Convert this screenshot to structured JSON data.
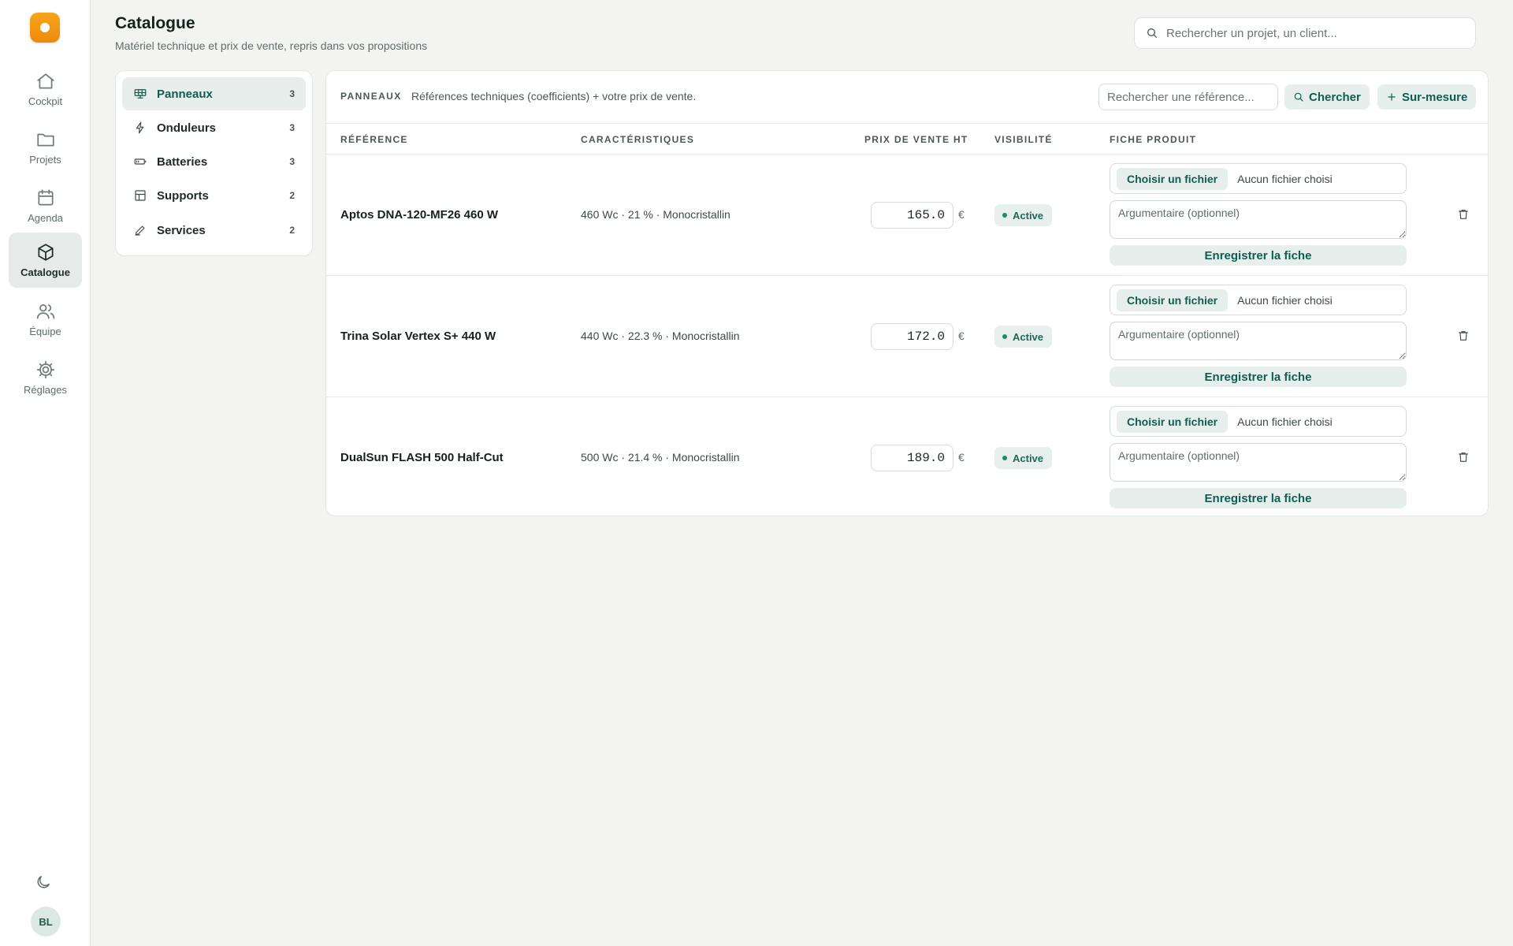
{
  "sidebar": {
    "nav": [
      {
        "label": "Cockpit",
        "icon": "home-icon",
        "active": false
      },
      {
        "label": "Projets",
        "icon": "folder-icon",
        "active": false
      },
      {
        "label": "Agenda",
        "icon": "calendar-icon",
        "active": false
      },
      {
        "label": "Catalogue",
        "icon": "box-icon",
        "active": true
      },
      {
        "label": "Équipe",
        "icon": "users-icon",
        "active": false
      },
      {
        "label": "Réglages",
        "icon": "gear-icon",
        "active": false
      }
    ],
    "user_initials": "BL"
  },
  "header": {
    "title": "Catalogue",
    "subtitle": "Matériel technique et prix de vente, repris dans vos propositions",
    "search_placeholder": "Rechercher un projet, un client..."
  },
  "categories": [
    {
      "label": "Panneaux",
      "count": "3",
      "icon": "solar-panel-icon",
      "active": true
    },
    {
      "label": "Onduleurs",
      "count": "3",
      "icon": "lightning-icon",
      "active": false
    },
    {
      "label": "Batteries",
      "count": "3",
      "icon": "battery-icon",
      "active": false
    },
    {
      "label": "Supports",
      "count": "2",
      "icon": "frame-icon",
      "active": false
    },
    {
      "label": "Services",
      "count": "2",
      "icon": "pen-icon",
      "active": false
    }
  ],
  "panel": {
    "kicker": "PANNEAUX",
    "description": "Références techniques (coefficients) + votre prix de vente.",
    "search_placeholder": "Rechercher une référence...",
    "search_button": "Chercher",
    "custom_button": "Sur-mesure"
  },
  "table": {
    "headers": {
      "reference": "RÉFÉRENCE",
      "specs": "CARACTÉRISTIQUES",
      "price": "PRIX DE VENTE HT",
      "visibility": "VISIBILITÉ",
      "sheet": "FICHE PRODUIT"
    },
    "rows": [
      {
        "reference": "Aptos DNA-120-MF26 460 W",
        "specs": "460 Wc · 21 % · Monocristallin",
        "price": "165.0",
        "currency": "€",
        "status": "Active",
        "file_button": "Choisir un fichier",
        "file_status": "Aucun fichier choisi",
        "argument_placeholder": "Argumentaire (optionnel)",
        "save_label": "Enregistrer la fiche"
      },
      {
        "reference": "Trina Solar Vertex S+ 440 W",
        "specs": "440 Wc · 22.3 % · Monocristallin",
        "price": "172.0",
        "currency": "€",
        "status": "Active",
        "file_button": "Choisir un fichier",
        "file_status": "Aucun fichier choisi",
        "argument_placeholder": "Argumentaire (optionnel)",
        "save_label": "Enregistrer la fiche"
      },
      {
        "reference": "DualSun FLASH 500 Half-Cut",
        "specs": "500 Wc · 21.4 % · Monocristallin",
        "price": "189.0",
        "currency": "€",
        "status": "Active",
        "file_button": "Choisir un fichier",
        "file_status": "Aucun fichier choisi",
        "argument_placeholder": "Argumentaire (optionnel)",
        "save_label": "Enregistrer la fiche"
      }
    ]
  },
  "colors": {
    "accent": "#0f5e4f",
    "accent_soft": "#e7efec",
    "brand_orange": "#f39a13",
    "background": "#f3f4f2"
  }
}
